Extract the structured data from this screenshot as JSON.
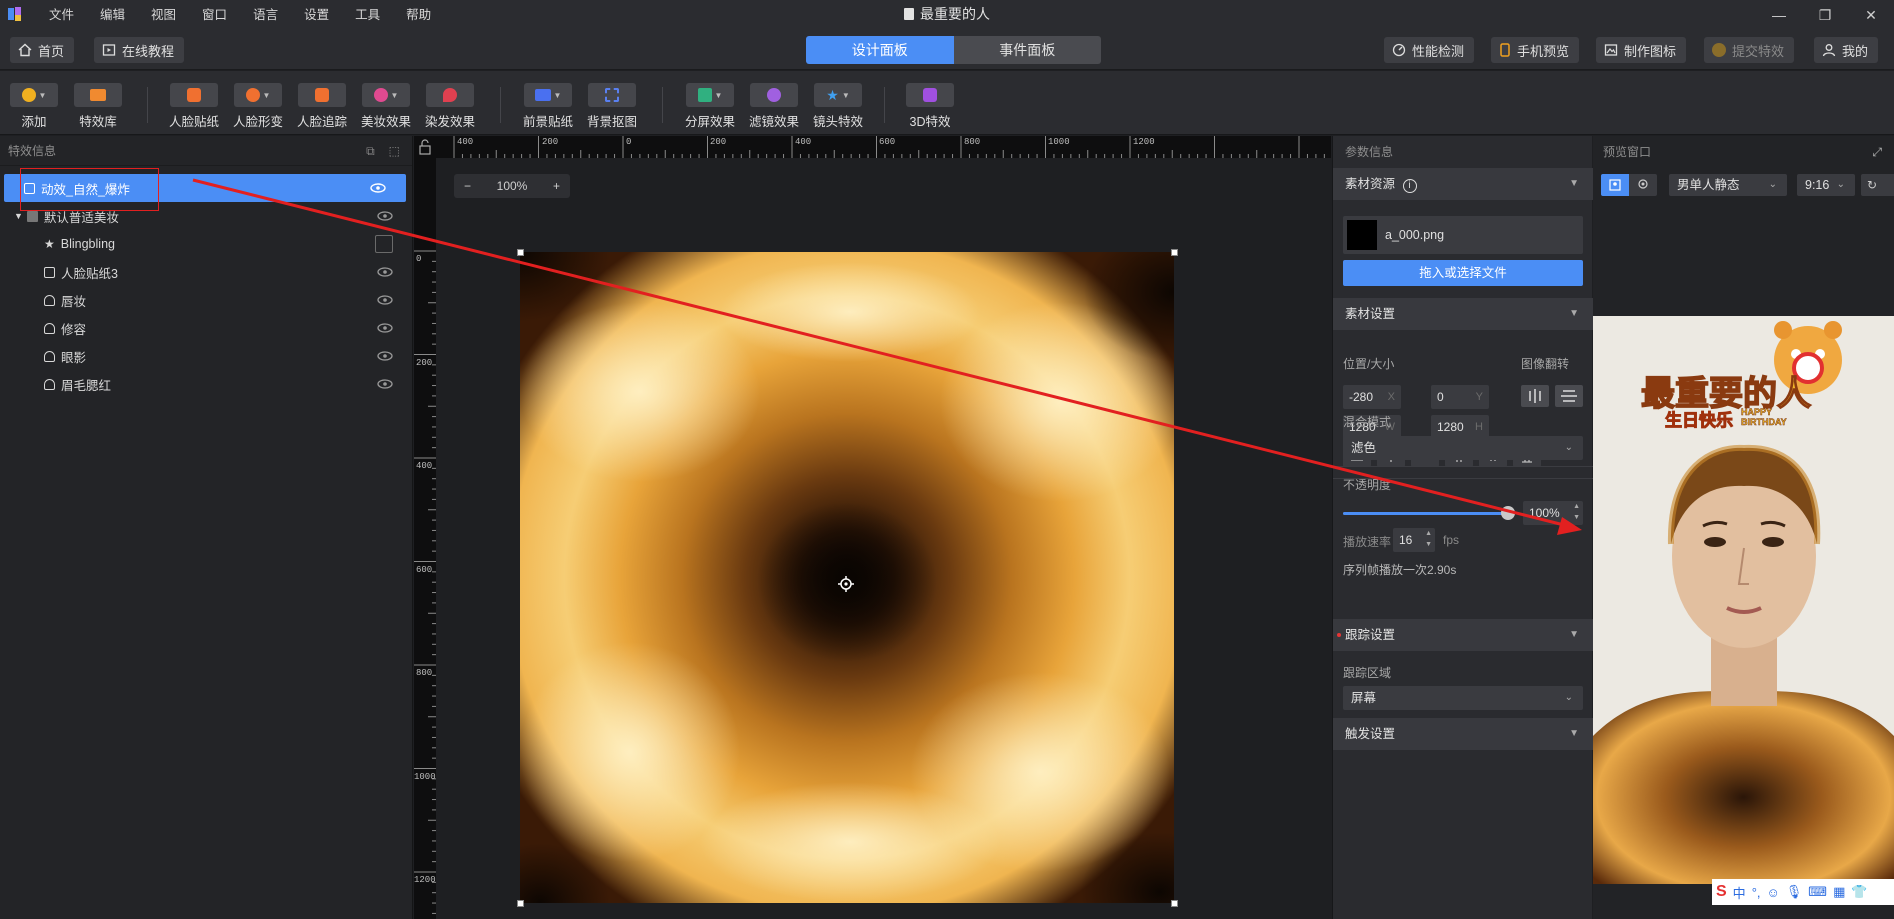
{
  "titlebar": {
    "menu": [
      "文件",
      "编辑",
      "视图",
      "窗口",
      "语言",
      "设置",
      "工具",
      "帮助"
    ],
    "doc_title": "最重要的人",
    "win_min": "—",
    "win_max": "❐",
    "win_close": "✕"
  },
  "nav": {
    "home": "首页",
    "tutorial": "在线教程",
    "tabs": [
      "设计面板",
      "事件面板"
    ],
    "perf": "性能检测",
    "phone": "手机预览",
    "make_icon": "制作图标",
    "submit": "提交特效",
    "mine": "我的"
  },
  "toolbar": {
    "items": [
      "添加",
      "特效库",
      "人脸贴纸",
      "人脸形变",
      "人脸追踪",
      "美妆效果",
      "染发效果",
      "前景贴纸",
      "背景抠图",
      "分屏效果",
      "滤镜效果",
      "镜头特效",
      "3D特效"
    ]
  },
  "left": {
    "title": "特效信息",
    "layers": [
      {
        "label": "动效_自然_爆炸",
        "icon": "image-icon"
      },
      {
        "label": "默认普适美妆",
        "icon": "folder-icon"
      },
      {
        "label": "Blingbling",
        "icon": "star-icon"
      },
      {
        "label": "人脸贴纸3",
        "icon": "sticker-icon"
      },
      {
        "label": "唇妆",
        "icon": "makeup-icon"
      },
      {
        "label": "修容",
        "icon": "makeup-icon"
      },
      {
        "label": "眼影",
        "icon": "makeup-icon"
      },
      {
        "label": "眉毛腮红",
        "icon": "makeup-icon"
      }
    ]
  },
  "canvas": {
    "zoom": "100%",
    "zoom_minus": "−",
    "zoom_plus": "+",
    "ruler_top": [
      "400",
      "200",
      "0",
      "200",
      "400",
      "600",
      "800",
      "1000",
      "1200"
    ],
    "ruler_left": [
      "0",
      "200",
      "400",
      "600",
      "800",
      "1000",
      "1200"
    ]
  },
  "params": {
    "title": "参数信息",
    "asset_section": "素材资源",
    "asset_file": "a_000.png",
    "asset_button": "拖入或选择文件",
    "settings_section": "素材设置",
    "pos_label": "位置/大小",
    "flip_label": "图像翻转",
    "x_value": "-280",
    "x_unit": "X",
    "y_value": "0",
    "y_unit": "Y",
    "w_value": "1280",
    "w_unit": "W",
    "h_value": "1280",
    "h_unit": "H",
    "blend_label": "混合模式",
    "blend_value": "滤色",
    "opacity_label": "不透明度",
    "opacity_value": "100%",
    "opacity_fraction": 1.0,
    "fps_label": "播放速率",
    "fps_value": "16",
    "fps_unit": "fps",
    "seq_info": "序列帧播放一次2.90s",
    "track_section": "跟踪设置",
    "track_area_label": "跟踪区域",
    "track_area_value": "屏幕",
    "trigger_section": "触发设置"
  },
  "preview": {
    "title": "预览窗口",
    "model": "男单人静态",
    "ratio": "9:16",
    "sticker_title": "最重要的人",
    "sticker_sub": "生日快乐",
    "sticker_en1": "HAPPY",
    "sticker_en2": "BIRTHDAY"
  },
  "ime": {
    "logo": "S",
    "lang": "中",
    "punct": "°,"
  },
  "colors": {
    "accent": "#4b8ef5",
    "annotation_red": "#e22020"
  }
}
